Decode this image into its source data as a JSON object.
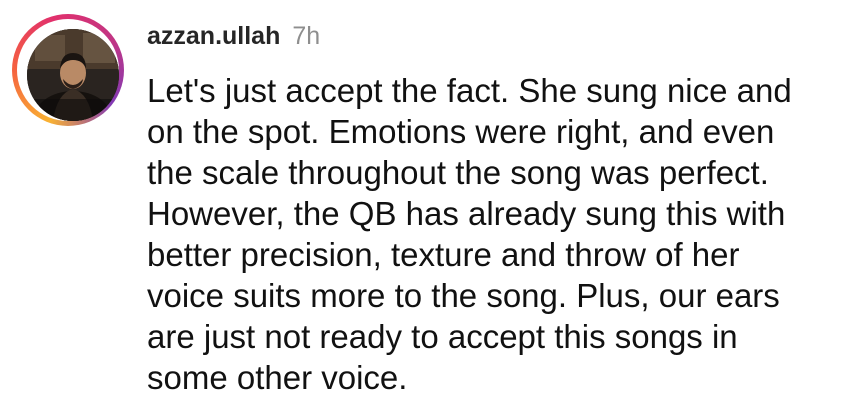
{
  "comment": {
    "username": "azzan.ullah",
    "timestamp": "7h",
    "text_lines": [
      "Let's just accept the fact. She sung nice and",
      "on the spot. Emotions were right, and even",
      "the scale throughout the song was perfect.",
      "However, the QB has already sung this with",
      "better precision, texture and throw of her",
      "voice suits more to the song. Plus, our ears",
      "are just not ready to accept this songs in",
      "some other voice."
    ]
  },
  "colors": {
    "username": "#262626",
    "timestamp": "#8e8e8e",
    "text": "#111111",
    "story_ring": [
      "#f9b233",
      "#f56040",
      "#e1306c",
      "#c13584",
      "#833ab4"
    ]
  }
}
